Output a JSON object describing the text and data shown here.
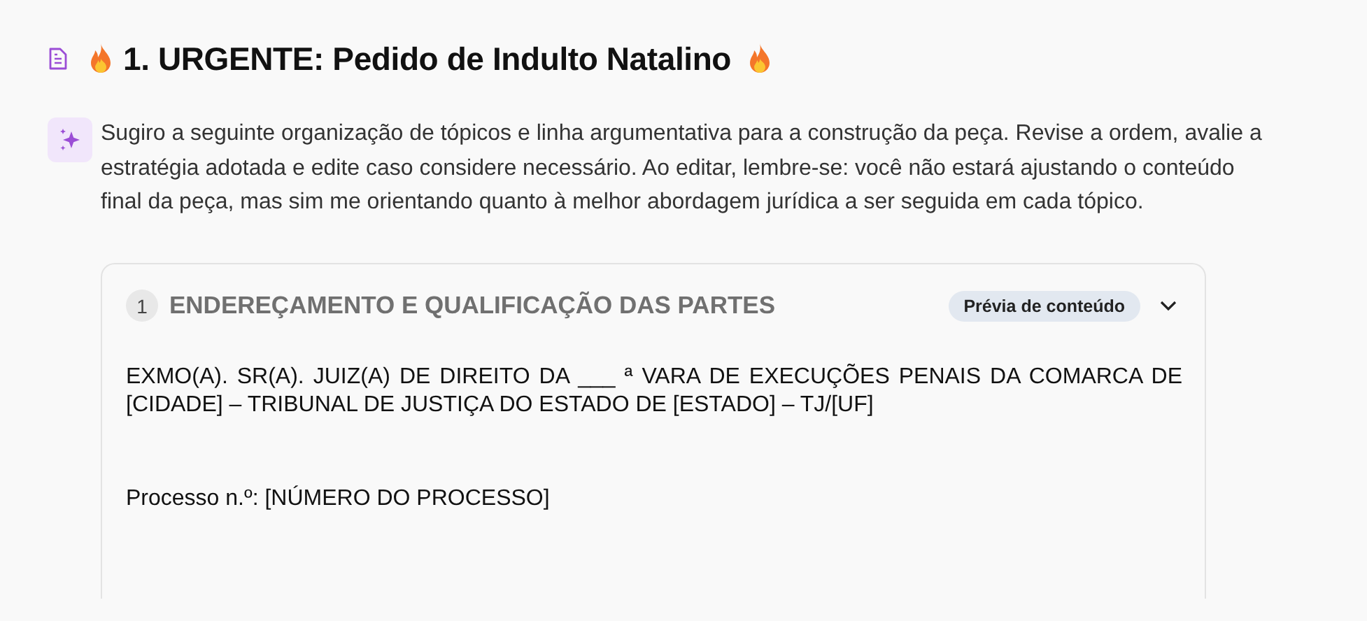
{
  "heading": {
    "title": "1. URGENTE: Pedido de Indulto Natalino"
  },
  "intro": "Sugiro a seguinte organização de tópicos e linha argumentativa para a construção da peça. Revise a ordem, avalie a estratégia adotada e edite caso considere necessário. Ao editar, lembre-se: você não estará ajustando o conteúdo final da peça, mas sim me orientando quanto à melhor abordagem jurídica a ser seguida em cada tópico.",
  "topics": [
    {
      "number": "1",
      "title": "ENDEREÇAMENTO E QUALIFICAÇÃO DAS PARTES",
      "badge": "Prévia de conteúdo",
      "expanded": true,
      "content": [
        "EXMO(A). SR(A). JUIZ(A) DE DIREITO DA ___ ª VARA DE EXECUÇÕES PENAIS DA COMARCA DE [CIDADE] – TRIBUNAL DE JUSTIÇA DO ESTADO DE [ESTADO] – TJ/[UF]",
        "Processo n.º: [NÚMERO DO PROCESSO]"
      ]
    }
  ]
}
